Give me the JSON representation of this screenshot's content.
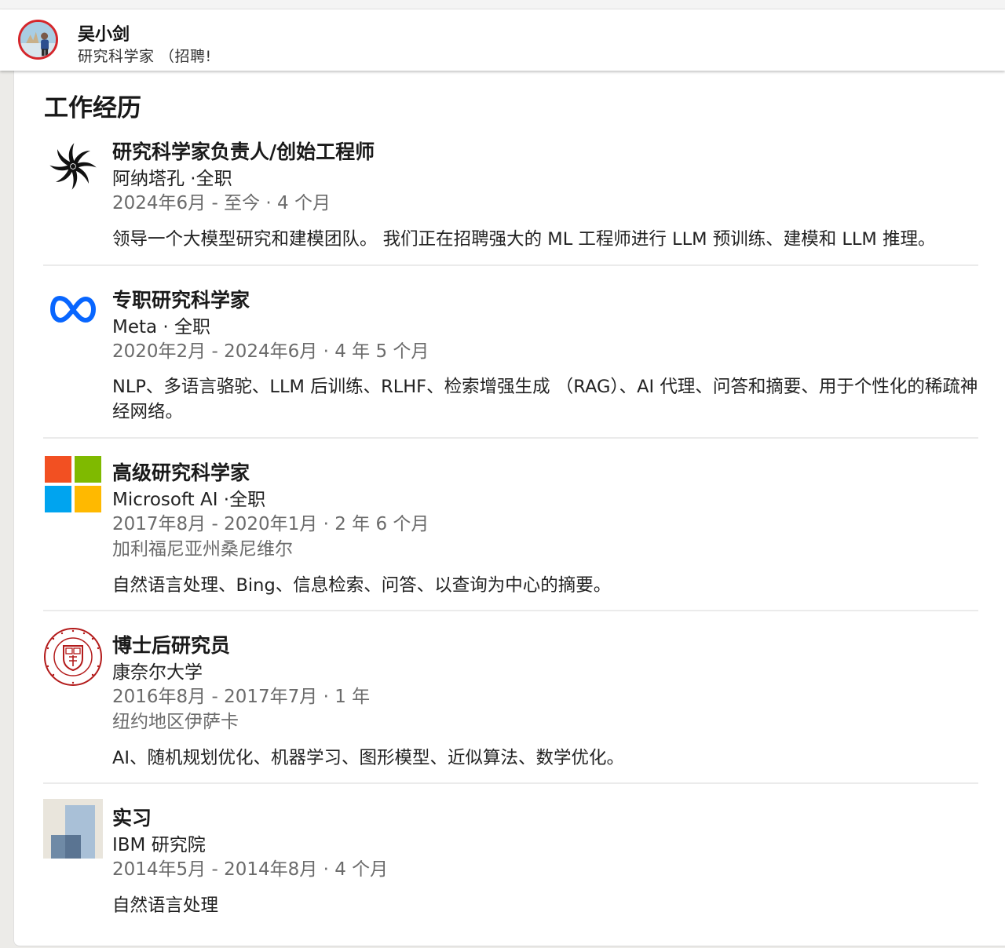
{
  "profile": {
    "name": "吴小剑",
    "headline": "研究科学家 （招聘!"
  },
  "section": {
    "title": "工作经历"
  },
  "experiences": [
    {
      "title": "研究科学家负责人/创始工程师",
      "company": "阿纳塔孔 ·全职",
      "dates": "2024年6月 - 至今 · 4 个月",
      "location": "",
      "description": "领导一个大模型研究和建模团队。 我们正在招聘强大的 ML 工程师进行 LLM 预训练、建模和 LLM 推理。",
      "logo_icon": "swirl-logo-icon"
    },
    {
      "title": "专职研究科学家",
      "company": "Meta · 全职",
      "dates": "2020年2月 - 2024年6月 · 4 年 5 个月",
      "location": "",
      "description": "NLP、多语言骆驼、LLM 后训练、RLHF、检索增强生成 （RAG）、AI 代理、问答和摘要、用于个性化的稀疏神经网络。",
      "logo_icon": "meta-logo-icon",
      "brand_color": "#0866ff"
    },
    {
      "title": "高级研究科学家",
      "company": "Microsoft AI ·全职",
      "dates": "2017年8月 - 2020年1月 · 2 年 6 个月",
      "location": "加利福尼亚州桑尼维尔",
      "description": "自然语言处理、Bing、信息检索、问答、以查询为中心的摘要。",
      "logo_icon": "microsoft-logo-icon",
      "brand_colors": [
        "#f25022",
        "#7fba00",
        "#00a4ef",
        "#ffb900"
      ]
    },
    {
      "title": "博士后研究员",
      "company": "康奈尔大学",
      "dates": "2016年8月 - 2017年7月 · 1 年",
      "location": "纽约地区伊萨卡",
      "description": "AI、随机规划优化、机器学习、图形模型、近似算法、数学优化。",
      "logo_icon": "cornell-seal-logo-icon",
      "brand_color": "#b31b1b"
    },
    {
      "title": "实习",
      "company": "IBM 研究院",
      "dates": "2014年5月 - 2014年8月 · 4 个月",
      "location": "",
      "description": "自然语言处理",
      "logo_icon": "placeholder-company-logo-icon"
    }
  ]
}
